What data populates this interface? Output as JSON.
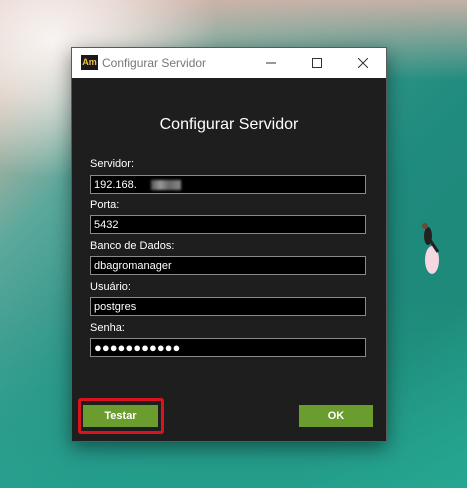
{
  "window": {
    "app_icon_text": "Am",
    "title": "Configurar Servidor"
  },
  "dialog": {
    "heading": "Configurar Servidor"
  },
  "form": {
    "server": {
      "label": "Servidor:",
      "value": "192.168."
    },
    "port": {
      "label": "Porta:",
      "value": "5432"
    },
    "database": {
      "label": "Banco de Dados:",
      "value": "dbagromanager"
    },
    "user": {
      "label": "Usuário:",
      "value": "postgres"
    },
    "password": {
      "label": "Senha:",
      "masked_value": "●●●●●●●●●●●"
    }
  },
  "buttons": {
    "test_label": "Testar",
    "ok_label": "OK"
  },
  "colors": {
    "accent_button": "#6a9c2e",
    "highlight_border": "#d9141e",
    "dialog_background": "#1e1e1e"
  }
}
